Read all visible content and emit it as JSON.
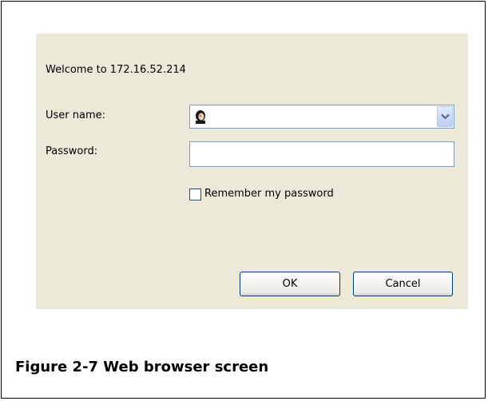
{
  "dialog": {
    "welcome_text": "Welcome to 172.16.52.214",
    "background_color": "#ece9d8"
  },
  "form": {
    "username_label": "User name:",
    "username_value": "",
    "username_icon": "user-icon",
    "password_label": "Password:",
    "password_value": "",
    "remember_label": "Remember my password",
    "remember_checked": false
  },
  "buttons": {
    "ok_label": "OK",
    "cancel_label": "Cancel"
  },
  "caption": {
    "text": "Figure 2-7 Web browser screen"
  }
}
